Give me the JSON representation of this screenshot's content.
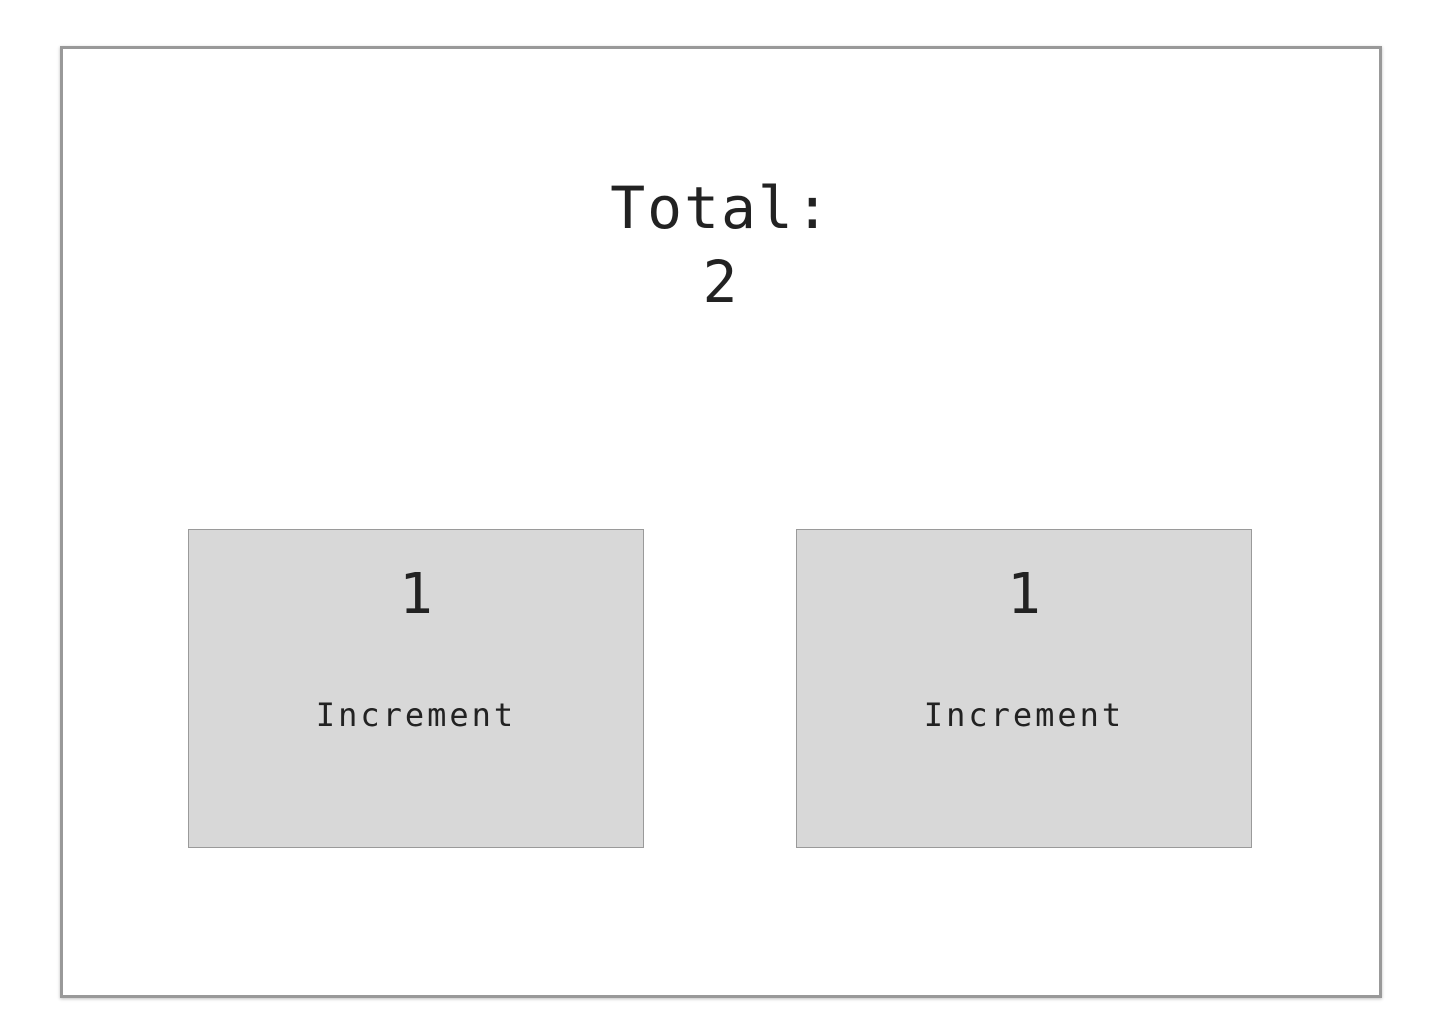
{
  "total": {
    "label": "Total:",
    "value": "2"
  },
  "counters": [
    {
      "value": "1",
      "button_label": "Increment"
    },
    {
      "value": "1",
      "button_label": "Increment"
    }
  ]
}
